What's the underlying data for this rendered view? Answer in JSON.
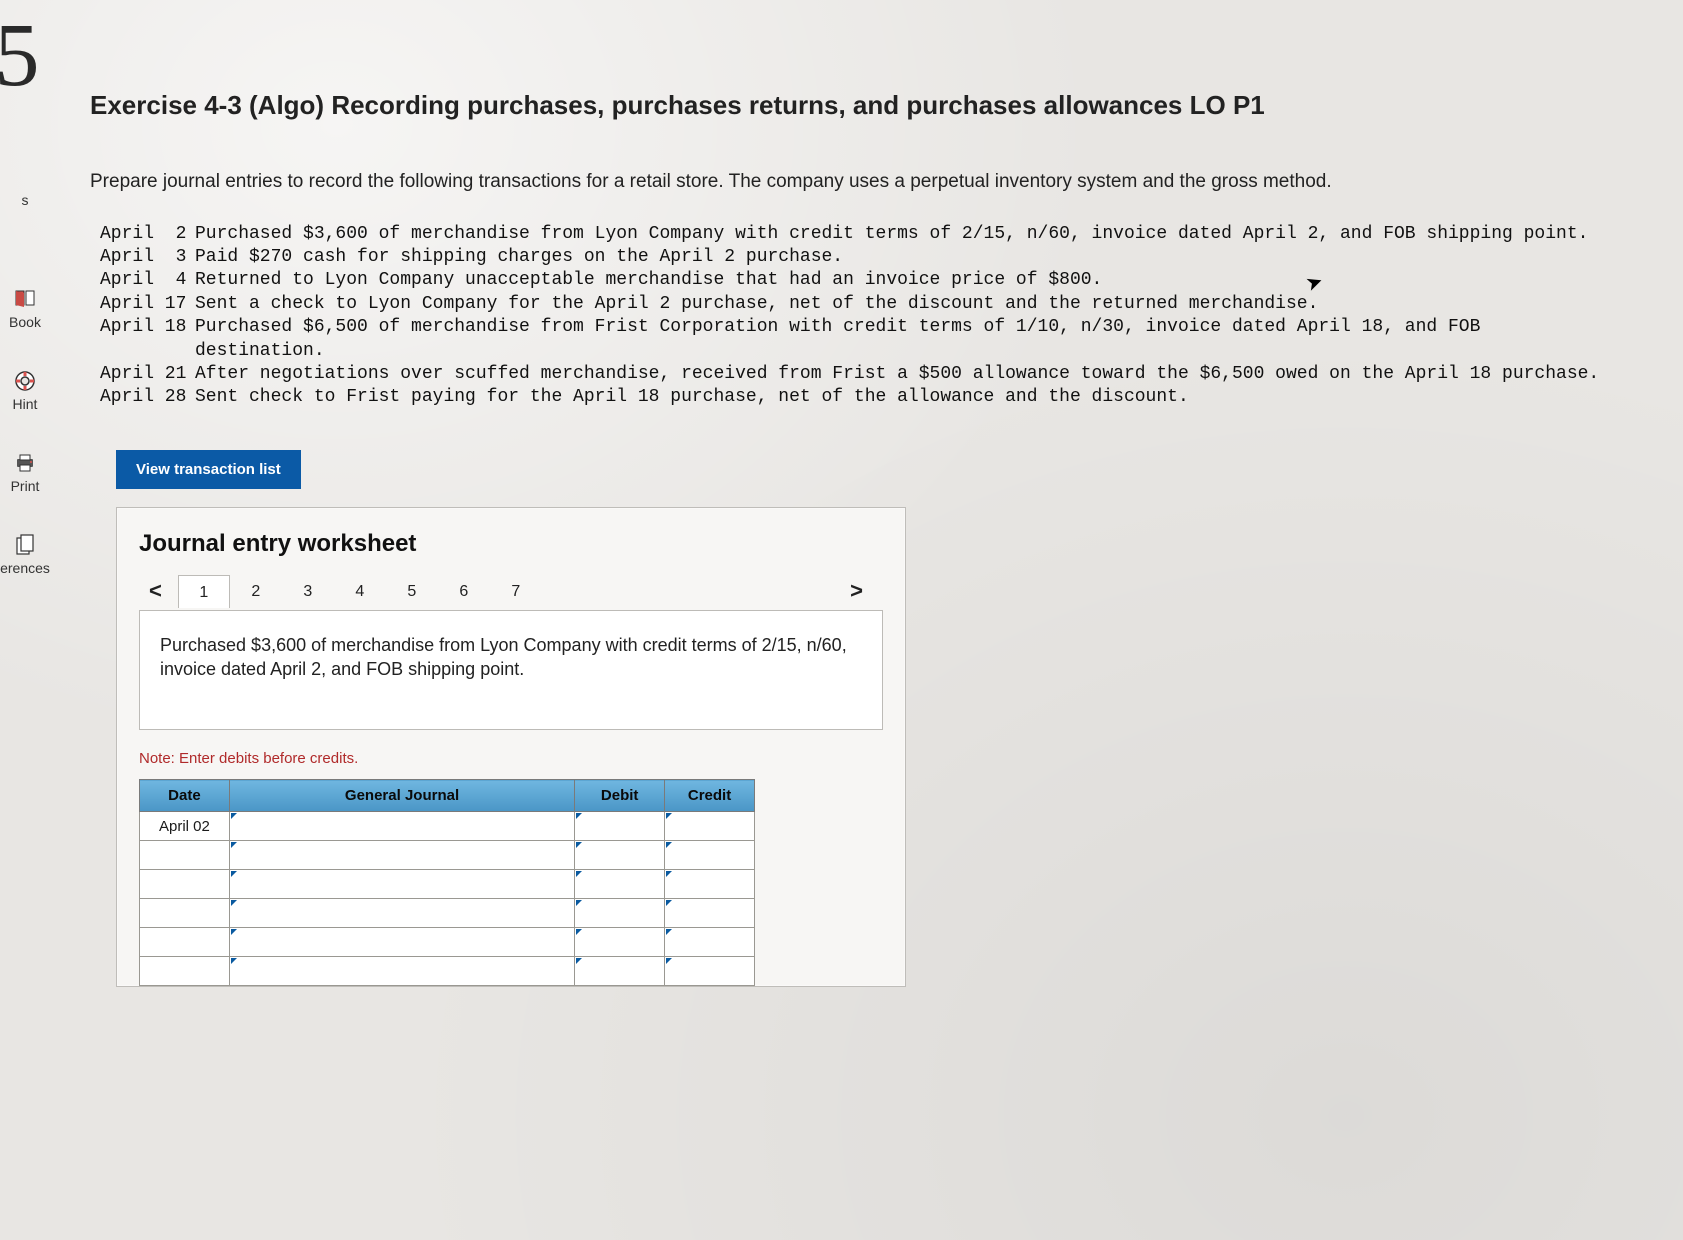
{
  "sidebar": {
    "big_number": "5",
    "items": [
      {
        "label": "s",
        "icon": ""
      },
      {
        "label": "Book",
        "icon": "book"
      },
      {
        "label": "Hint",
        "icon": "life-ring"
      },
      {
        "label": "Print",
        "icon": "printer"
      },
      {
        "label": "erences",
        "icon": "copy"
      }
    ]
  },
  "title": "Exercise 4-3 (Algo) Recording purchases, purchases returns, and purchases allowances LO P1",
  "instructions": "Prepare journal entries to record the following transactions for a retail store. The company uses a perpetual inventory system and the gross method.",
  "transactions": [
    {
      "date": "April  2",
      "desc": "Purchased $3,600 of merchandise from Lyon Company with credit terms of 2/15, n/60, invoice dated April 2, and FOB shipping point."
    },
    {
      "date": "April  3",
      "desc": "Paid $270 cash for shipping charges on the April 2 purchase."
    },
    {
      "date": "April  4",
      "desc": "Returned to Lyon Company unacceptable merchandise that had an invoice price of $800."
    },
    {
      "date": "April 17",
      "desc": "Sent a check to Lyon Company for the April 2 purchase, net of the discount and the returned merchandise."
    },
    {
      "date": "April 18",
      "desc": "Purchased $6,500 of merchandise from Frist Corporation with credit terms of 1/10, n/30, invoice dated April 18, and FOB destination."
    },
    {
      "date": "April 21",
      "desc": "After negotiations over scuffed merchandise, received from Frist a $500 allowance toward the $6,500 owed on the April 18 purchase."
    },
    {
      "date": "April 28",
      "desc": "Sent check to Frist paying for the April 18 purchase, net of the allowance and the discount."
    }
  ],
  "view_button": "View transaction list",
  "worksheet": {
    "heading": "Journal entry worksheet",
    "prev": "<",
    "next": ">",
    "tabs": [
      "1",
      "2",
      "3",
      "4",
      "5",
      "6",
      "7"
    ],
    "active_tab": 0,
    "description": "Purchased $3,600 of merchandise from Lyon Company with credit terms of 2/15, n/60, invoice dated April 2, and FOB shipping point.",
    "note": "Note: Enter debits before credits.",
    "columns": {
      "date": "Date",
      "gj": "General Journal",
      "debit": "Debit",
      "credit": "Credit"
    },
    "rows": [
      {
        "date": "April 02",
        "gj": "",
        "debit": "",
        "credit": ""
      },
      {
        "date": "",
        "gj": "",
        "debit": "",
        "credit": ""
      },
      {
        "date": "",
        "gj": "",
        "debit": "",
        "credit": ""
      },
      {
        "date": "",
        "gj": "",
        "debit": "",
        "credit": ""
      },
      {
        "date": "",
        "gj": "",
        "debit": "",
        "credit": ""
      },
      {
        "date": "",
        "gj": "",
        "debit": "",
        "credit": ""
      }
    ]
  }
}
